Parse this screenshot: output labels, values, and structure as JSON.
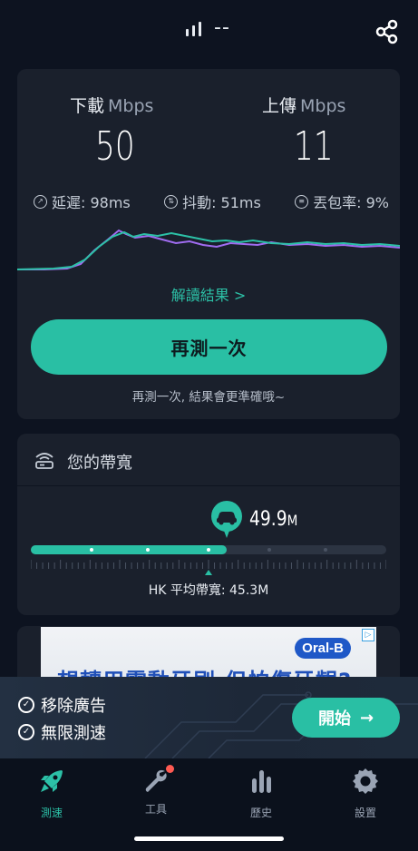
{
  "status": {
    "signal_text": "--"
  },
  "result": {
    "download_label": "下載",
    "download_unit": "Mbps",
    "download_value": "50",
    "upload_label": "上傳",
    "upload_unit": "Mbps",
    "upload_value": "11",
    "latency": "延遲: 98ms",
    "jitter": "抖動: 51ms",
    "packet_loss": "丟包率: 9%",
    "interpret_link": "解讀結果 >",
    "retest_button": "再測一次",
    "retest_hint": "再測一次, 結果會更準確哦~",
    "colors": {
      "download_line": "#a06cf0",
      "upload_line": "#2cc1a7",
      "accent": "#29bfa4"
    }
  },
  "bandwidth": {
    "title": "您的帶寬",
    "value": "49.9",
    "value_unit": "M",
    "avg_label": "HK 平均帶寬: 45.3M",
    "fill_fraction": 0.55,
    "avg_fraction": 0.5
  },
  "ad": {
    "brand": "Oral-B",
    "headline": "想轉用電動牙刷,但怕傷牙齦?",
    "ad_mark": "▷"
  },
  "promo": {
    "item1": "移除廣告",
    "item2": "無限測速",
    "start_button": "開始",
    "start_arrow": "→"
  },
  "tabs": [
    {
      "label": "測速",
      "icon": "rocket-icon",
      "active": true
    },
    {
      "label": "工具",
      "icon": "wrench-icon",
      "active": false,
      "badge": true
    },
    {
      "label": "歷史",
      "icon": "bar-chart-icon",
      "active": false
    },
    {
      "label": "設置",
      "icon": "gear-icon",
      "active": false
    }
  ]
}
